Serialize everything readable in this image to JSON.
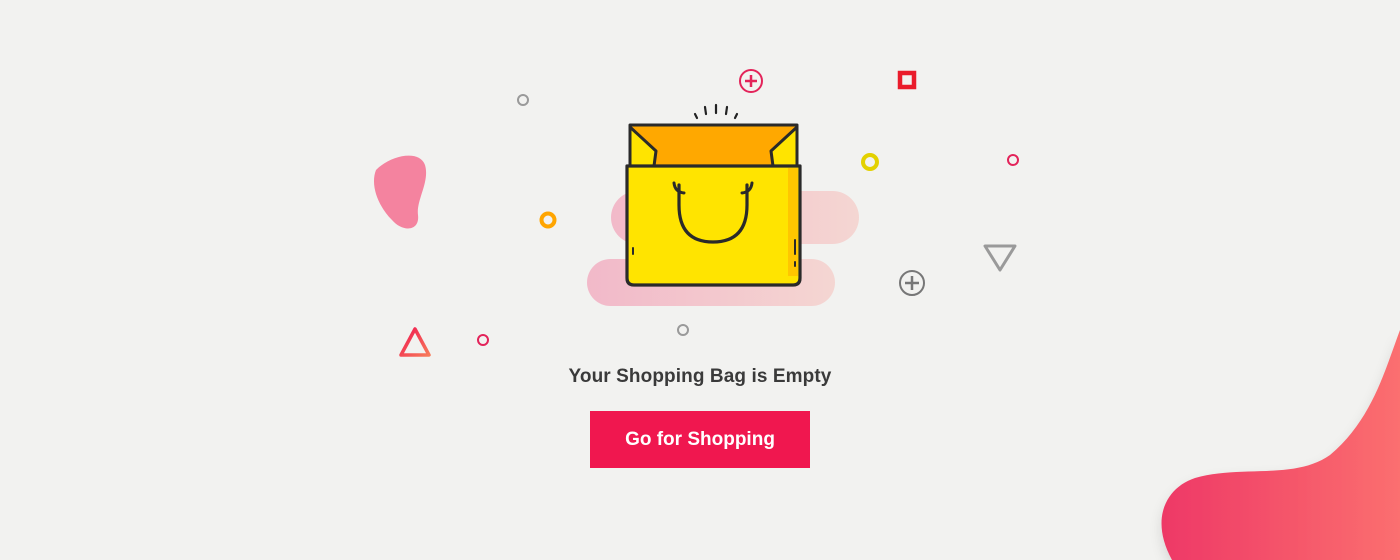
{
  "empty_state": {
    "message": "Your Shopping Bag is Empty",
    "button_label": "Go for Shopping",
    "illustration_icon": "shopping-bag-icon"
  },
  "colors": {
    "background": "#f2f2f0",
    "accent": "#f0174f",
    "bag_yellow": "#ffe400",
    "bag_orange": "#ffa800",
    "blob_pink": "#f07f9f"
  }
}
